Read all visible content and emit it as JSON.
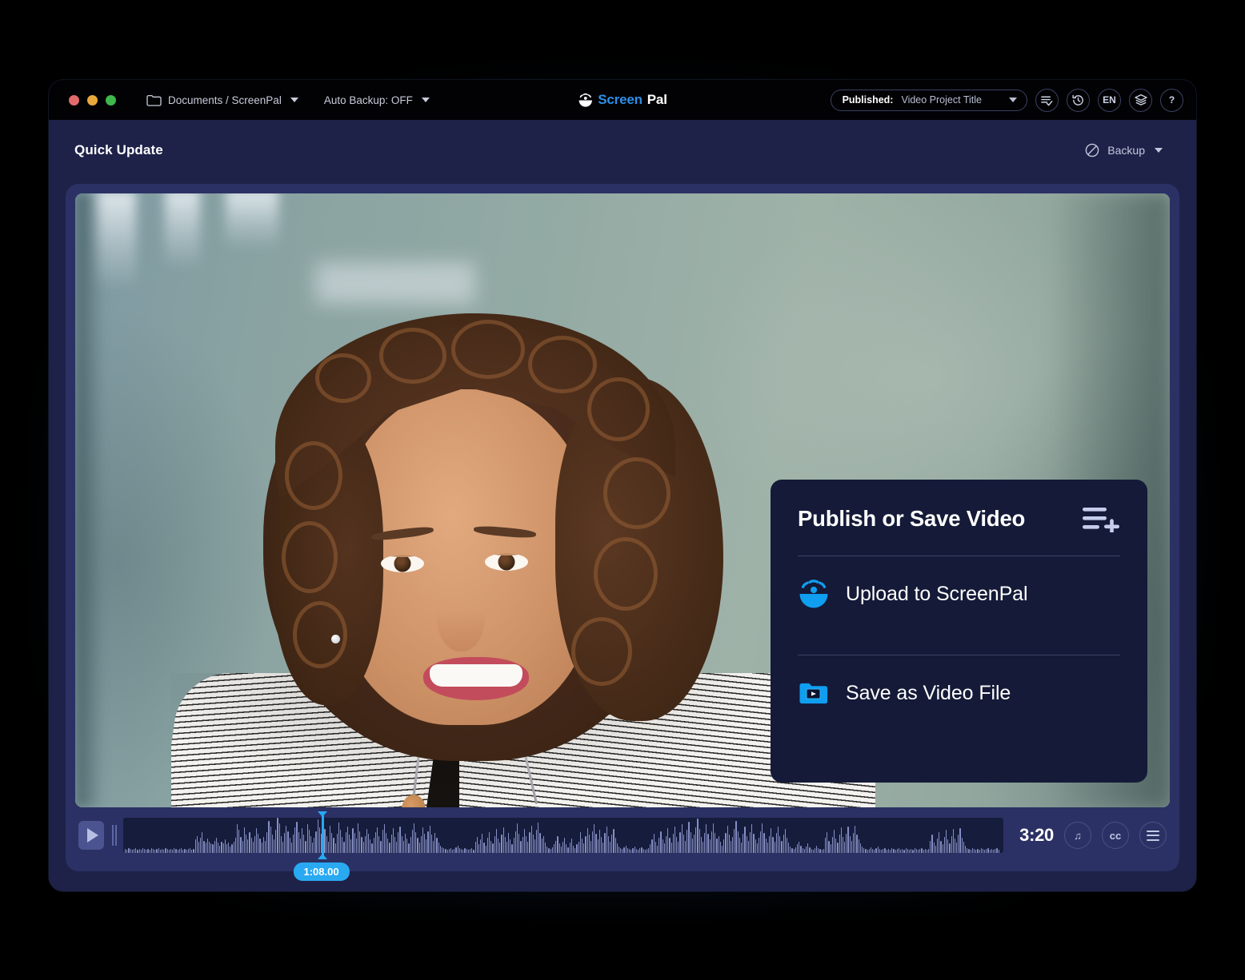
{
  "titlebar": {
    "traffic_lights": [
      "close",
      "minimize",
      "maximize"
    ],
    "folder_icon": "folder-icon",
    "path_label": "Documents / ScreenPal",
    "auto_backup_label": "Auto Backup: OFF",
    "brand": {
      "first": "Screen",
      "second": "Pal"
    },
    "project_pill": {
      "status_label": "Published:",
      "project_title": "Video Project Title"
    },
    "icons": [
      {
        "name": "list-check-icon",
        "label": ""
      },
      {
        "name": "history-icon",
        "label": ""
      },
      {
        "name": "language-icon",
        "label": "EN"
      },
      {
        "name": "layers-icon",
        "label": ""
      },
      {
        "name": "help-icon",
        "label": "?"
      }
    ]
  },
  "subbar": {
    "page_title": "Quick Update",
    "backup_label": "Backup",
    "backup_icon": "no-backup-icon"
  },
  "publish_panel": {
    "title": "Publish or Save Video",
    "header_icon": "list-add-icon",
    "items": [
      {
        "icon": "screenpal-upload-icon",
        "label": "Upload to ScreenPal"
      },
      {
        "icon": "video-folder-icon",
        "label": "Save as Video File"
      }
    ]
  },
  "timeline": {
    "play_icon": "play-icon",
    "playhead_time": "1:08.00",
    "playhead_percent": 22.5,
    "total_duration": "3:20",
    "controls": [
      {
        "name": "music-icon",
        "label": "♫"
      },
      {
        "name": "captions-icon",
        "label": "cc"
      },
      {
        "name": "menu-icon",
        "label": ""
      }
    ],
    "waveform": [
      4,
      3,
      5,
      4,
      3,
      4,
      5,
      3,
      4,
      3,
      5,
      4,
      3,
      4,
      3,
      5,
      4,
      3,
      4,
      5,
      3,
      4,
      3,
      5,
      4,
      3,
      4,
      3,
      5,
      4,
      3,
      4,
      5,
      3,
      4,
      3,
      4,
      5,
      3,
      4,
      14,
      18,
      12,
      16,
      22,
      13,
      11,
      15,
      12,
      10,
      9,
      13,
      16,
      11,
      8,
      12,
      10,
      14,
      9,
      11,
      7,
      9,
      12,
      16,
      30,
      24,
      17,
      13,
      27,
      19,
      14,
      22,
      16,
      12,
      18,
      26,
      20,
      15,
      11,
      17,
      13,
      22,
      34,
      28,
      19,
      14,
      24,
      37,
      31,
      18,
      12,
      21,
      29,
      23,
      16,
      11,
      19,
      27,
      33,
      22,
      15,
      26,
      19,
      13,
      30,
      24,
      18,
      11,
      16,
      23,
      35,
      27,
      20,
      14,
      25,
      18,
      12,
      29,
      21,
      16,
      10,
      20,
      32,
      24,
      17,
      12,
      22,
      28,
      19,
      14,
      26,
      21,
      15,
      31,
      23,
      17,
      12,
      18,
      25,
      20,
      14,
      10,
      16,
      22,
      27,
      18,
      13,
      24,
      30,
      21,
      15,
      11,
      19,
      26,
      17,
      12,
      22,
      28,
      18,
      13,
      20,
      15,
      10,
      17,
      24,
      31,
      22,
      16,
      11,
      18,
      27,
      20,
      14,
      23,
      29,
      19,
      13,
      21,
      16,
      11,
      8,
      6,
      5,
      4,
      3,
      4,
      5,
      3,
      4,
      6,
      8,
      5,
      4,
      3,
      5,
      4,
      3,
      4,
      5,
      3,
      12,
      17,
      9,
      14,
      20,
      11,
      8,
      16,
      22,
      13,
      10,
      18,
      25,
      15,
      11,
      19,
      27,
      17,
      12,
      21,
      14,
      9,
      16,
      23,
      31,
      20,
      13,
      17,
      25,
      18,
      12,
      22,
      29,
      19,
      14,
      24,
      32,
      21,
      15,
      18,
      11,
      7,
      5,
      4,
      6,
      9,
      13,
      18,
      10,
      7,
      12,
      16,
      9,
      6,
      11,
      15,
      8,
      5,
      9,
      12,
      22,
      15,
      10,
      18,
      26,
      19,
      13,
      23,
      30,
      20,
      14,
      24,
      17,
      11,
      21,
      28,
      18,
      12,
      19,
      25,
      16,
      10,
      7,
      5,
      4,
      6,
      8,
      5,
      4,
      3,
      5,
      7,
      4,
      3,
      5,
      6,
      4,
      3,
      4,
      5,
      9,
      14,
      20,
      12,
      8,
      16,
      23,
      14,
      10,
      18,
      26,
      16,
      11,
      20,
      28,
      17,
      12,
      22,
      30,
      19,
      13,
      24,
      33,
      22,
      15,
      19,
      27,
      36,
      25,
      17,
      12,
      21,
      30,
      20,
      14,
      23,
      31,
      21,
      15,
      18,
      12,
      8,
      14,
      21,
      29,
      19,
      13,
      17,
      25,
      34,
      23,
      16,
      11,
      20,
      28,
      18,
      13,
      22,
      30,
      20,
      14,
      10,
      16,
      23,
      31,
      21,
      15,
      11,
      18,
      26,
      17,
      12,
      21,
      28,
      18,
      13,
      19,
      25,
      16,
      11,
      7,
      5,
      4,
      6,
      9,
      12,
      8,
      5,
      4,
      7,
      10,
      6,
      4,
      3,
      5,
      8,
      5,
      4,
      3,
      4,
      16,
      22,
      13,
      9,
      17,
      24,
      15,
      11,
      19,
      27,
      17,
      12,
      20,
      28,
      18,
      13,
      21,
      29,
      19,
      14,
      10,
      7,
      5,
      4,
      3,
      4,
      6,
      4,
      3,
      5,
      7,
      4,
      3,
      4,
      5,
      3,
      4,
      3,
      5,
      4,
      3,
      4,
      5,
      3,
      4,
      3,
      5,
      4,
      3,
      4,
      3,
      5,
      4,
      3,
      4,
      5,
      3,
      4,
      3,
      4,
      13,
      19,
      11,
      8,
      15,
      22,
      13,
      9,
      17,
      24,
      14,
      10,
      18,
      25,
      15,
      11,
      19,
      26,
      16,
      12,
      8,
      5,
      4,
      3,
      5,
      4,
      3,
      4,
      3,
      5,
      4,
      3,
      4,
      5,
      3,
      4,
      3,
      4,
      5,
      3
    ]
  },
  "colors": {
    "accent_blue": "#29a9f2",
    "brand_blue": "#2f8fe8",
    "window_bg": "#1e2249",
    "card_bg": "#2b3164",
    "panel_bg": "#141a37",
    "titlebar_bg": "#020204"
  }
}
